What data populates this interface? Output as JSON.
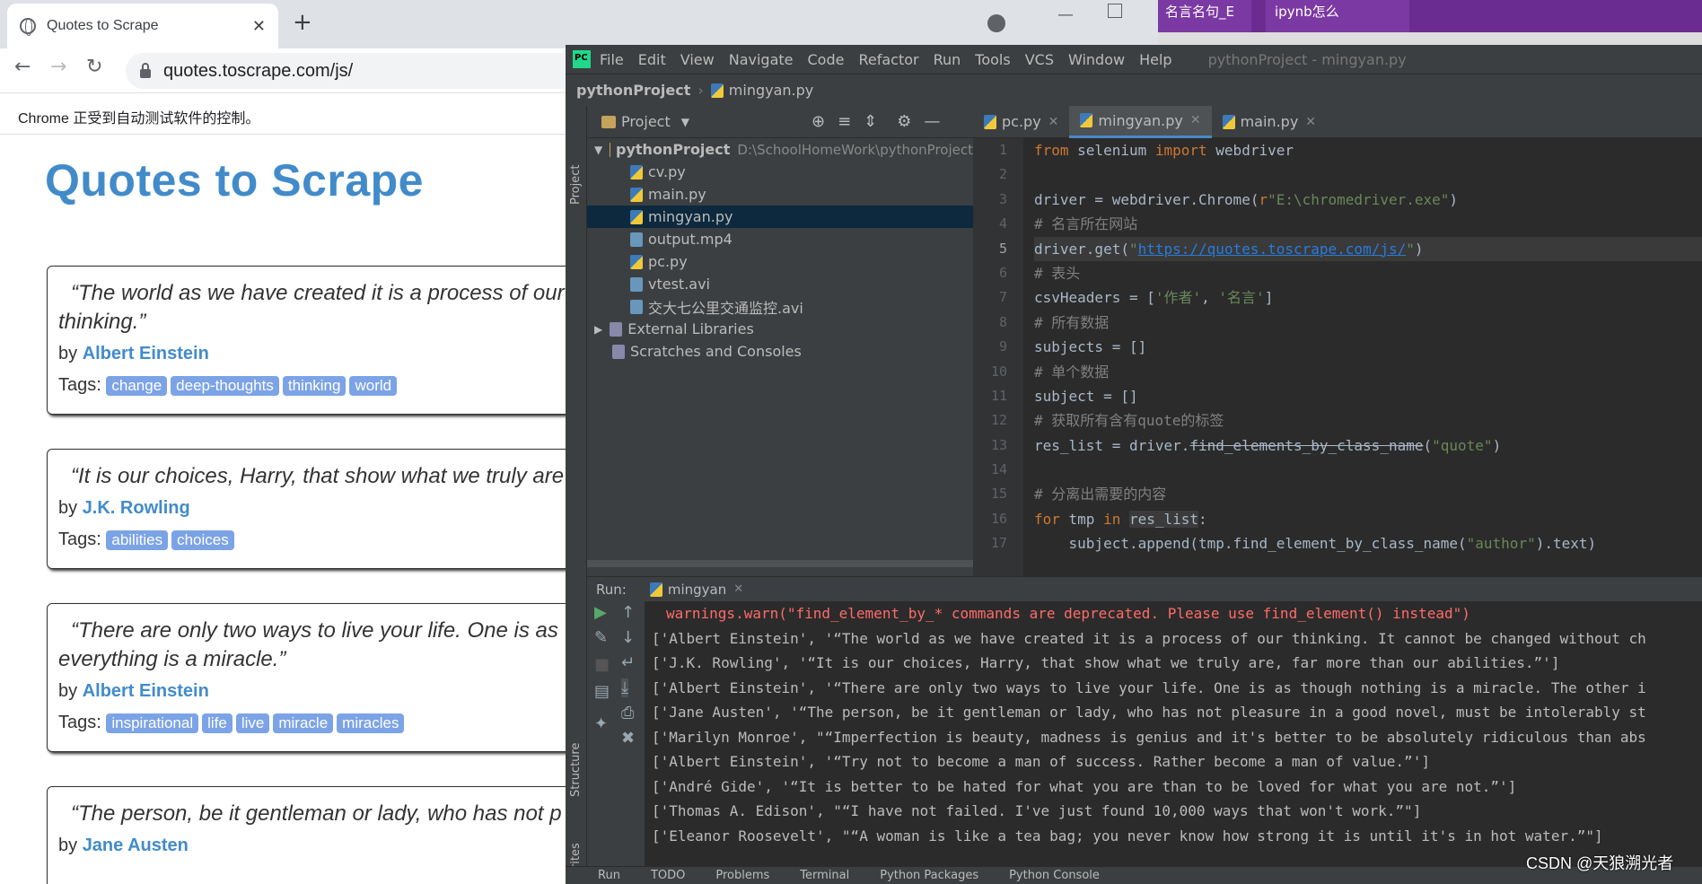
{
  "chrome": {
    "tab_title": "Quotes to Scrape",
    "url": "quotes.toscrape.com/js/",
    "infobar": "Chrome 正受到自动测试软件的控制。",
    "site_title": "Quotes to Scrape",
    "quotes": [
      {
        "text": "“The world as we have created it is a process of our",
        "text2": "thinking.”",
        "author": "Albert Einstein",
        "tags": [
          "change",
          "deep-thoughts",
          "thinking",
          "world"
        ]
      },
      {
        "text": "“It is our choices, Harry, that show what we truly are",
        "text2": "",
        "author": "J.K. Rowling",
        "tags": [
          "abilities",
          "choices"
        ]
      },
      {
        "text": "“There are only two ways to live your life. One is as",
        "text2": "everything is a miracle.”",
        "author": "Albert Einstein",
        "tags": [
          "inspirational",
          "life",
          "live",
          "miracle",
          "miracles"
        ]
      },
      {
        "text": "“The person, be it gentleman or lady, who has not p",
        "text2": "",
        "author": "Jane Austen",
        "tags": []
      }
    ],
    "by_label": "by",
    "tags_label": "Tags:"
  },
  "bgwin": {
    "tab1": "名言名句_E",
    "tab2": "ipynb怎么"
  },
  "ide": {
    "menu": [
      "File",
      "Edit",
      "View",
      "Navigate",
      "Code",
      "Refactor",
      "Run",
      "Tools",
      "VCS",
      "Window",
      "Help"
    ],
    "title": "pythonProject - mingyan.py",
    "nav_project": "pythonProject",
    "nav_file": "mingyan.py",
    "project_label": "Project",
    "tree": [
      {
        "name": "pythonProject",
        "path": "D:\\SchoolHomeWork\\pythonProject",
        "kind": "folder"
      },
      {
        "name": "cv.py",
        "kind": "py"
      },
      {
        "name": "main.py",
        "kind": "py"
      },
      {
        "name": "mingyan.py",
        "kind": "py"
      },
      {
        "name": "output.mp4",
        "kind": "vid"
      },
      {
        "name": "pc.py",
        "kind": "py"
      },
      {
        "name": "vtest.avi",
        "kind": "vid"
      },
      {
        "name": "交大七公里交通监控.avi",
        "kind": "vid"
      },
      {
        "name": "External Libraries",
        "kind": "lib"
      },
      {
        "name": "Scratches and Consoles",
        "kind": "lib"
      }
    ],
    "editor_tabs": [
      "pc.py",
      "mingyan.py",
      "main.py"
    ],
    "line_numbers": [
      "1",
      "2",
      "3",
      "4",
      "5",
      "6",
      "7",
      "8",
      "9",
      "10",
      "11",
      "12",
      "13",
      "14",
      "15",
      "16",
      "17"
    ],
    "run_label": "Run:",
    "run_tab": "mingyan",
    "console": [
      "warnings.warn(\"find_element_by_* commands are deprecated. Please use find_element() instead\")",
      "['Albert Einstein', '“The world as we have created it is a process of our thinking. It cannot be changed without ch",
      "['J.K. Rowling', '“It is our choices, Harry, that show what we truly are, far more than our abilities.”']",
      "['Albert Einstein', '“There are only two ways to live your life. One is as though nothing is a miracle. The other i",
      "['Jane Austen', '“The person, be it gentleman or lady, who has not pleasure in a good novel, must be intolerably st",
      "['Marilyn Monroe', \"“Imperfection is beauty, madness is genius and it's better to be absolutely ridiculous than abs",
      "['Albert Einstein', '“Try not to become a man of success. Rather become a man of value.”']",
      "['André Gide', '“It is better to be hated for what you are than to be loved for what you are not.”']",
      "['Thomas A. Edison', \"“I have not failed. I've just found 10,000 ways that won't work.”\"]",
      "['Eleanor Roosevelt', \"“A woman is like a tea bag; you never know how strong it is until it's in hot water.”\"]"
    ],
    "status_items": [
      "Run",
      "TODO",
      "Problems",
      "Terminal",
      "Python Packages",
      "Python Console"
    ],
    "strip_labels": [
      "Project",
      "Structure",
      "Favorites"
    ]
  },
  "watermark": "CSDN @天狼溯光者"
}
